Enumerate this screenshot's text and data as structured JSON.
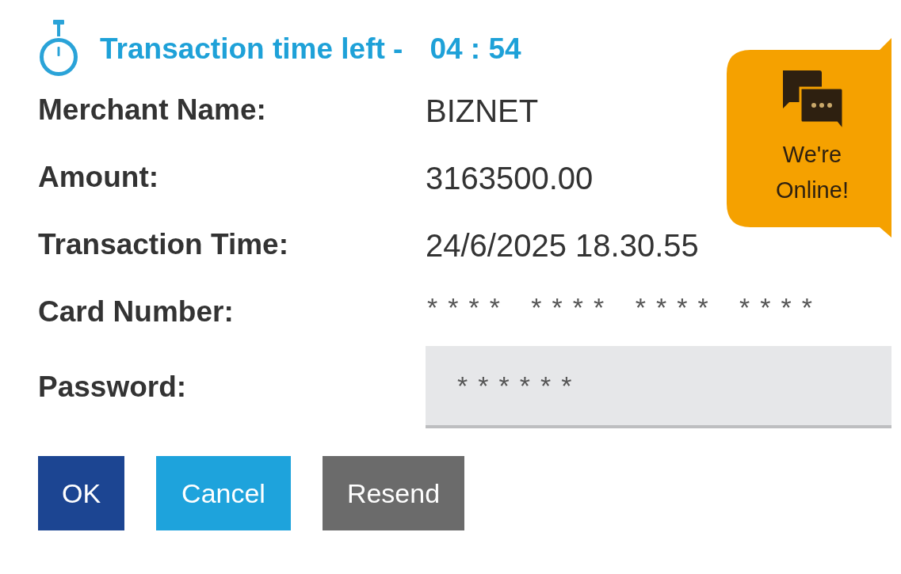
{
  "timer": {
    "label": "Transaction time left -",
    "time": "04 : 54"
  },
  "details": [
    {
      "label": "Merchant Name:",
      "value": "BIZNET",
      "kind": "text"
    },
    {
      "label": "Amount:",
      "value": "3163500.00",
      "kind": "text"
    },
    {
      "label": "Transaction Time:",
      "value": "24/6/2025 18.30.55",
      "kind": "text"
    },
    {
      "label": "Card Number:",
      "value": "**** **** **** ****",
      "kind": "masked"
    }
  ],
  "password": {
    "label": "Password:",
    "value": "******"
  },
  "buttons": [
    {
      "label": "OK",
      "kind": "primary"
    },
    {
      "label": "Cancel",
      "kind": "info"
    },
    {
      "label": "Resend",
      "kind": "secondary"
    }
  ],
  "chat_widget": {
    "label": "We're Online!"
  }
}
